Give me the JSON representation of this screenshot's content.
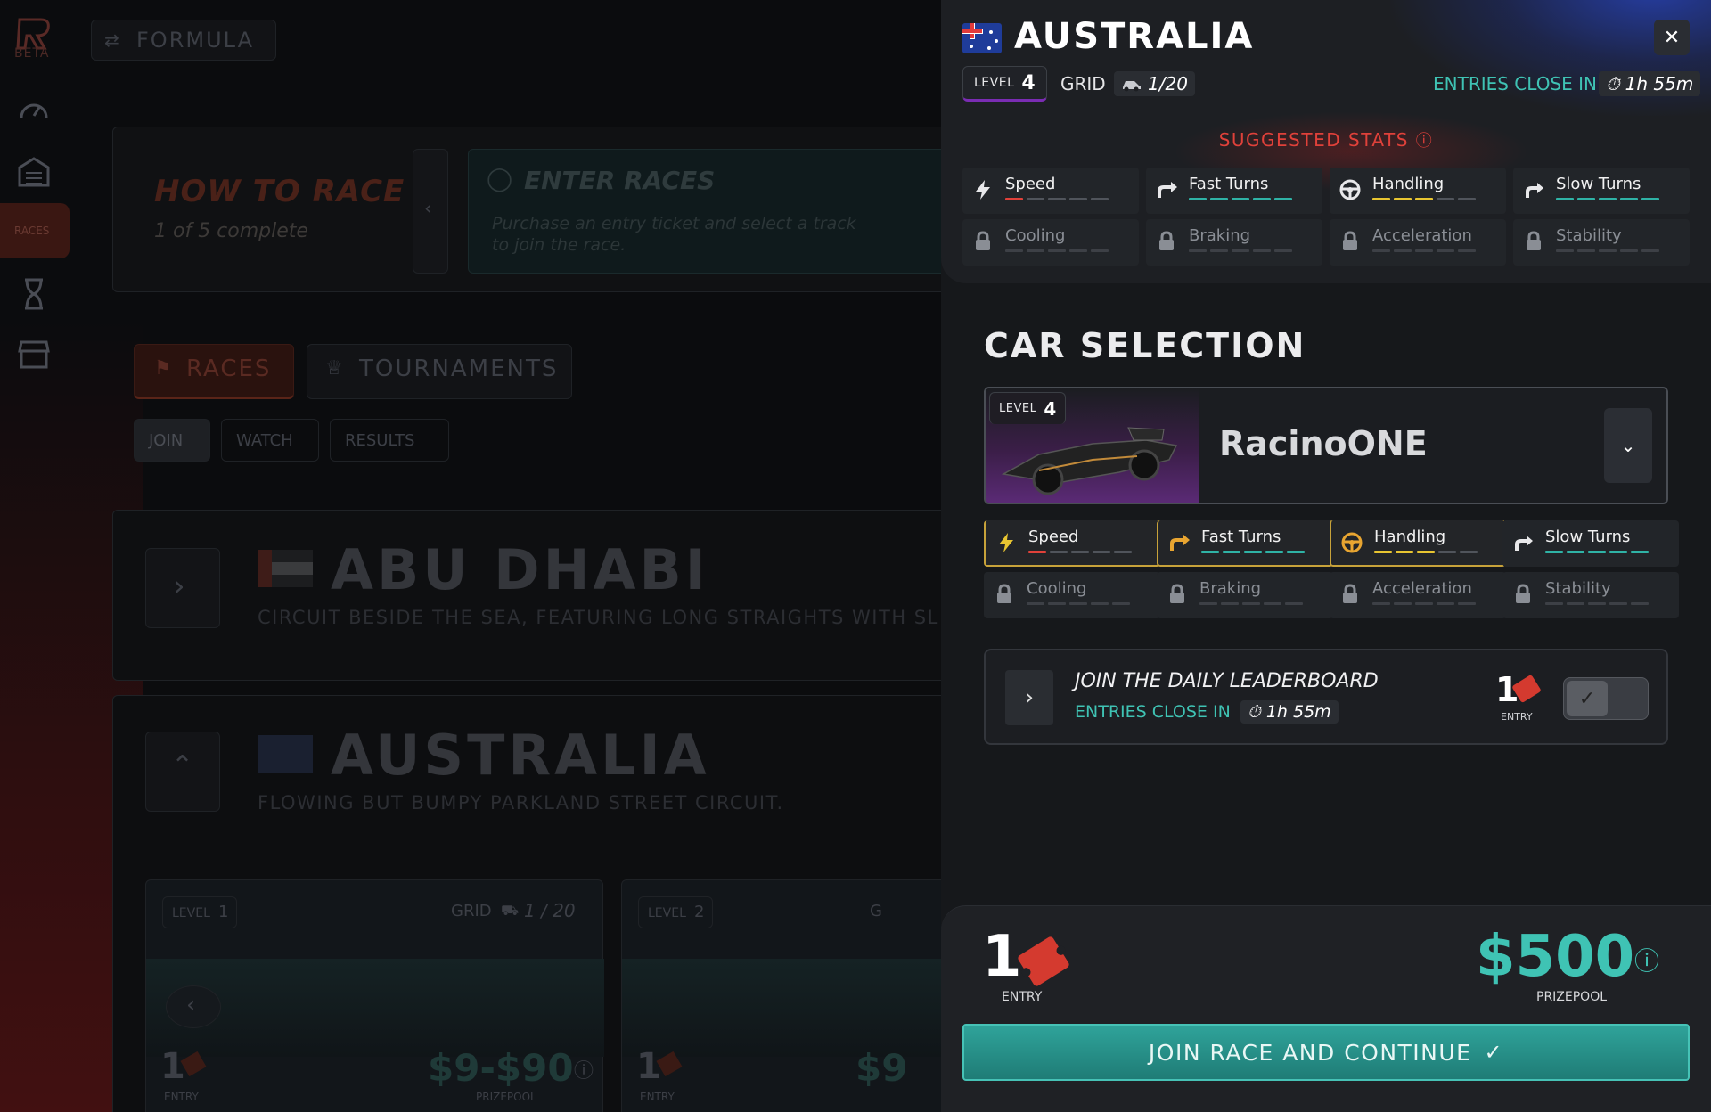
{
  "background": {
    "logo_text": "BETA",
    "formula_label": "FORMULA",
    "sidebar_active_label": "RACES",
    "how_to_race_title": "HOW TO RACE",
    "how_to_race_progress": "1 of 5 complete",
    "enter_races_title": "ENTER RACES",
    "enter_races_desc_1": "Purchase an entry ticket and select a track",
    "enter_races_desc_2": "to join the race.",
    "tabs": [
      "RACES",
      "TOURNAMENTS"
    ],
    "subtabs": [
      "JOIN",
      "WATCH",
      "RESULTS"
    ],
    "tracks": [
      {
        "name": "ABU DHABI",
        "desc": "CIRCUIT BESIDE THE SEA, FEATURING LONG STRAIGHTS WITH SL"
      },
      {
        "name": "AUSTRALIA",
        "desc": "FLOWING BUT BUMPY PARKLAND STREET CIRCUIT."
      }
    ],
    "race_cards": [
      {
        "level_label": "LEVEL",
        "level": "1",
        "grid_label": "GRID",
        "grid": "1 / 20",
        "entry_count": "1",
        "entry_label": "ENTRY",
        "prize": "$9-$90",
        "prize_label": "PRIZEPOOL"
      },
      {
        "level_label": "LEVEL",
        "level": "2",
        "grid_label": "G",
        "entry_count": "1",
        "entry_label": "ENTRY",
        "prize": "$9"
      }
    ]
  },
  "panel": {
    "country": "AUSTRALIA",
    "level_label": "LEVEL",
    "level": "4",
    "grid_label": "GRID",
    "grid_value": "1/20",
    "entries_close_label": "ENTRIES CLOSE IN",
    "entries_close_time": "1h 55m",
    "close_icon": "close-icon",
    "suggested_title": "SUGGESTED STATS",
    "suggested_stats": [
      {
        "name": "Speed",
        "icon": "bolt-icon",
        "color": "#e0413a",
        "filled": 1,
        "locked": false
      },
      {
        "name": "Fast Turns",
        "icon": "fast-turn-icon",
        "color": "#2fb3a6",
        "filled": 5,
        "locked": false
      },
      {
        "name": "Handling",
        "icon": "steering-wheel-icon",
        "color": "#e8c531",
        "filled": 3,
        "locked": false
      },
      {
        "name": "Slow Turns",
        "icon": "slow-turn-icon",
        "color": "#2fb3a6",
        "filled": 5,
        "locked": false
      },
      {
        "name": "Cooling",
        "icon": "lock-icon",
        "locked": true
      },
      {
        "name": "Braking",
        "icon": "lock-icon",
        "locked": true
      },
      {
        "name": "Acceleration",
        "icon": "lock-icon",
        "locked": true
      },
      {
        "name": "Stability",
        "icon": "lock-icon",
        "locked": true
      }
    ],
    "car_selection_title": "CAR SELECTION",
    "car": {
      "level_label": "LEVEL",
      "level": "4",
      "name": "RacinoONE"
    },
    "car_stats": [
      {
        "name": "Speed",
        "icon": "bolt-icon",
        "color": "#e0413a",
        "filled": 1,
        "locked": false,
        "highlight": true
      },
      {
        "name": "Fast Turns",
        "icon": "fast-turn-icon",
        "color": "#2fb3a6",
        "filled": 5,
        "locked": false,
        "highlight": true
      },
      {
        "name": "Handling",
        "icon": "steering-wheel-icon",
        "color": "#e8c531",
        "filled": 3,
        "locked": false,
        "highlight": true
      },
      {
        "name": "Slow Turns",
        "icon": "slow-turn-icon",
        "color": "#2fb3a6",
        "filled": 5,
        "locked": false,
        "highlight": false
      },
      {
        "name": "Cooling",
        "icon": "lock-icon",
        "locked": true
      },
      {
        "name": "Braking",
        "icon": "lock-icon",
        "locked": true
      },
      {
        "name": "Acceleration",
        "icon": "lock-icon",
        "locked": true
      },
      {
        "name": "Stability",
        "icon": "lock-icon",
        "locked": true
      }
    ],
    "leaderboard": {
      "title": "JOIN THE DAILY LEADERBOARD",
      "entries_close_label": "ENTRIES CLOSE IN",
      "time": "1h 55m",
      "entry_count": "1",
      "entry_label": "ENTRY"
    },
    "footer": {
      "entry_count": "1",
      "entry_label": "ENTRY",
      "prize": "$500",
      "prize_label": "PRIZEPOOL",
      "cta_label": "JOIN RACE AND CONTINUE"
    }
  },
  "colors": {
    "accent_teal": "#2fb3a6",
    "accent_red": "#e0413a",
    "accent_yellow": "#e8c531",
    "level_purple": "#7a2cb3"
  }
}
